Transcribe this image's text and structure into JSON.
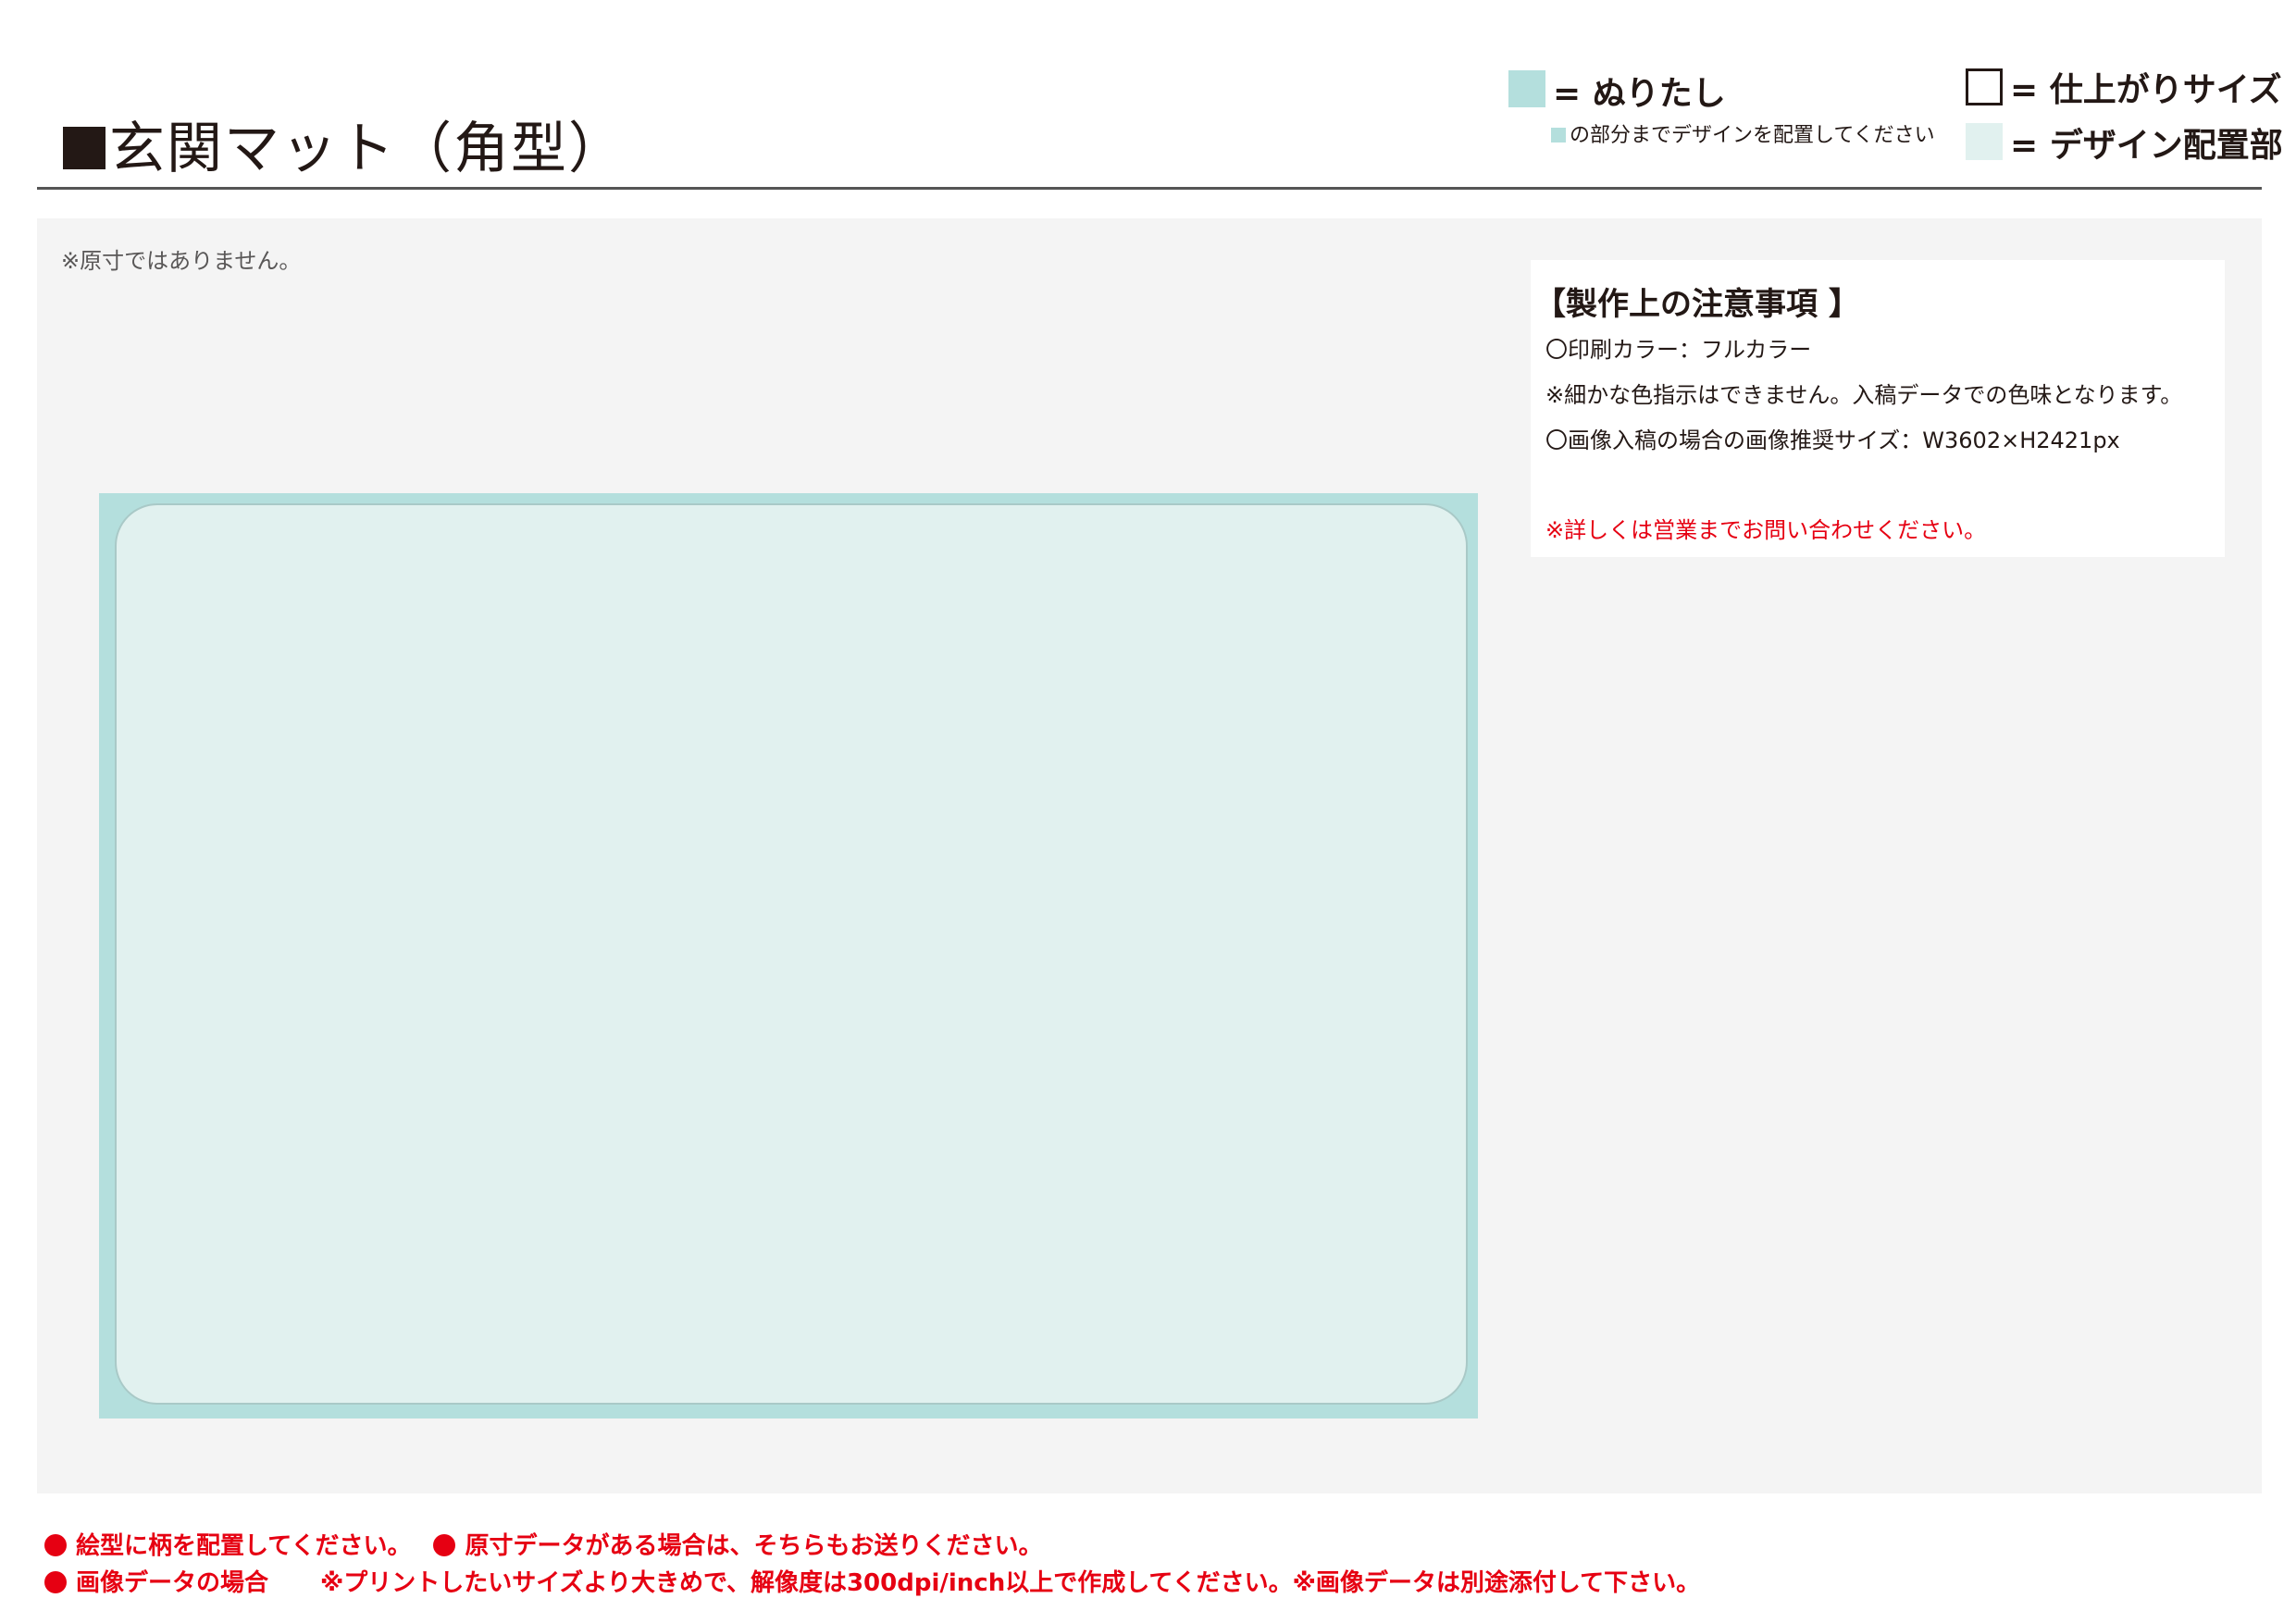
{
  "header": {
    "title": "玄関マット（角型）"
  },
  "legend": {
    "bleed_label": "= ぬりたし",
    "bleed_note": "の部分までデザインを配置してください",
    "finish_label": "= 仕上がりサイズ",
    "design_label": "= デザイン配置部",
    "colors": {
      "bleed": "#b4dfdd",
      "design": "#e1f1ef",
      "finish": "#ffffff"
    }
  },
  "canvas": {
    "scale_note": "※原寸ではありません。"
  },
  "notes": {
    "title": "【製作上の注意事項 】",
    "line1": "〇印刷カラー：フルカラー",
    "line2": "※細かな色指示はできません。入稿データでの色味となります。",
    "line3": "〇画像入稿の場合の画像推奨サイズ：W3602×H2421px",
    "line4": "※詳しくは営業までお問い合わせください。"
  },
  "footer": {
    "item1": "絵型に柄を配置してください。",
    "item2": "原寸データがある場合は、そちらもお送りください。",
    "item3": "画像データの場合",
    "item3_detail": "※プリントしたいサイズより大きめで、解像度は300dpi/inch以上で作成してください。※画像データは別途添付して下さい。",
    "accent_color": "#e60012"
  }
}
